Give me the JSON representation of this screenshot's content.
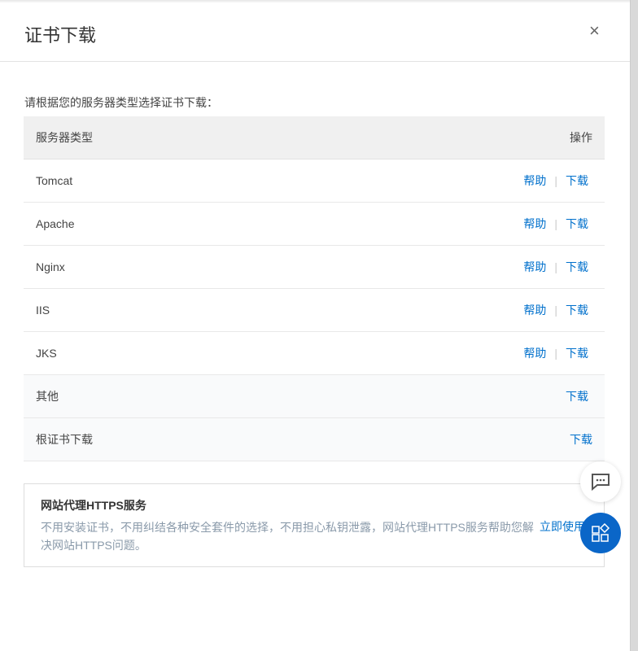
{
  "dialog": {
    "title": "证书下载",
    "close_icon": "×"
  },
  "intro": "请根据您的服务器类型选择证书下载：",
  "table": {
    "headers": [
      "服务器类型",
      "操作"
    ],
    "rows": [
      {
        "type": "Tomcat",
        "help": "帮助",
        "download": "下载"
      },
      {
        "type": "Apache",
        "help": "帮助",
        "download": "下载"
      },
      {
        "type": "Nginx",
        "help": "帮助",
        "download": "下载"
      },
      {
        "type": "IIS",
        "help": "帮助",
        "download": "下载"
      },
      {
        "type": "JKS",
        "help": "帮助",
        "download": "下载"
      },
      {
        "type": "其他",
        "download": "下载"
      },
      {
        "type": "根证书下载",
        "download": "下载"
      }
    ]
  },
  "promo": {
    "title": "网站代理HTTPS服务",
    "text": "不用安装证书，不用纠结各种安全套件的选择，不用担心私钥泄露，网站代理HTTPS服务帮助您解决网站HTTPS问题。",
    "action": "立即使用"
  }
}
